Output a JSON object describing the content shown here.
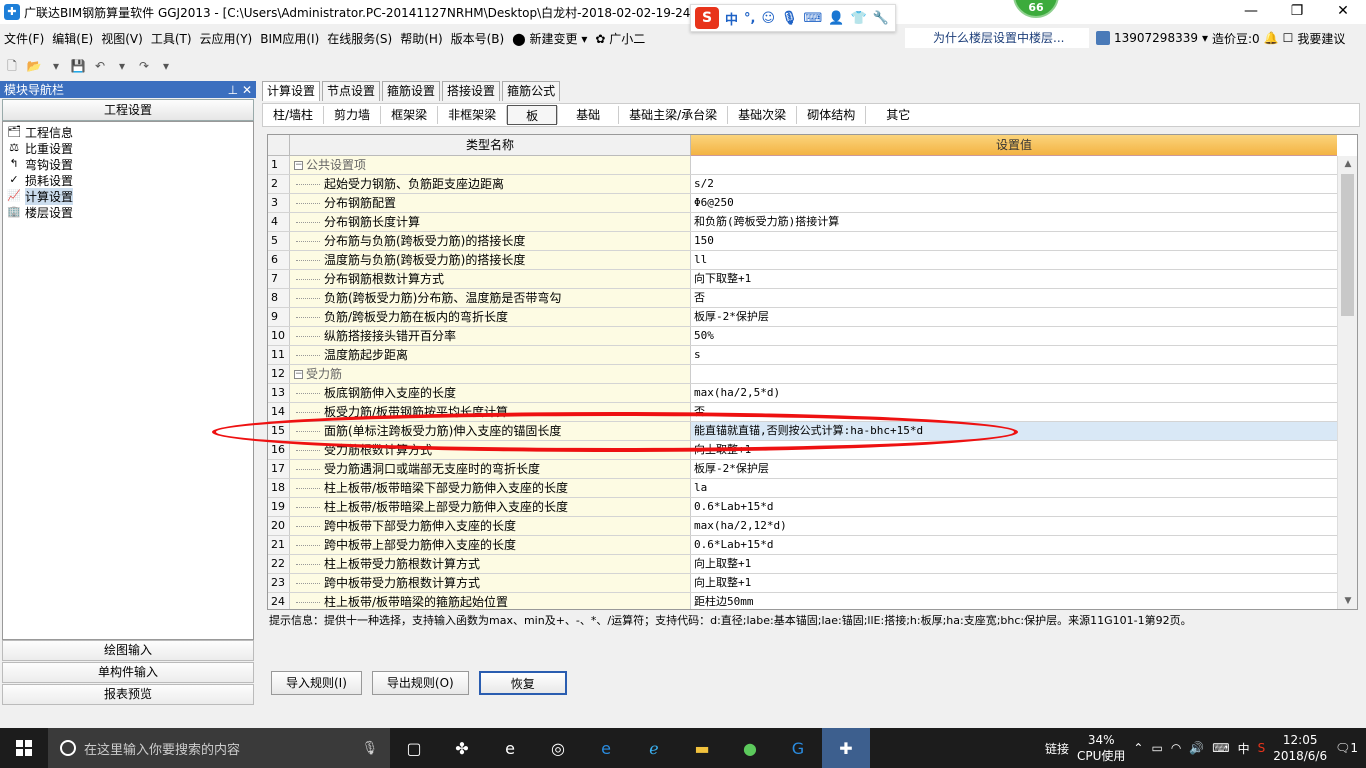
{
  "window": {
    "title": "广联达BIM钢筋算量软件 GGJ2013 - [C:\\Users\\Administrator.PC-20141127NRHM\\Desktop\\白龙村-2018-02-02-19-24-35(2666版).GGJ12]",
    "badge": "66",
    "ime": {
      "logo": "S",
      "items": [
        "中",
        "°,",
        "☺",
        "🎙",
        "⌨",
        "👤",
        "👕",
        "🔧"
      ]
    }
  },
  "menu": {
    "items": [
      "文件(F)",
      "编辑(E)",
      "视图(V)",
      "工具(T)",
      "云应用(Y)",
      "BIM应用(I)",
      "在线服务(S)",
      "帮助(H)",
      "版本号(B)",
      "新建变更",
      "广小二"
    ],
    "ad": "为什么楼层设置中楼层...",
    "phone": "13907298339",
    "cost_label": "造价豆:0",
    "suggest": "我要建议"
  },
  "left_panel": {
    "title": "模块导航栏",
    "section_button": "工程设置",
    "tree": [
      {
        "label": "工程信息",
        "icon": "info-icon"
      },
      {
        "label": "比重设置",
        "icon": "ratio-icon"
      },
      {
        "label": "弯钩设置",
        "icon": "hook-icon"
      },
      {
        "label": "损耗设置",
        "icon": "loss-icon"
      },
      {
        "label": "计算设置",
        "icon": "calc-icon"
      },
      {
        "label": "楼层设置",
        "icon": "floor-icon"
      }
    ],
    "bottom_buttons": [
      "绘图输入",
      "单构件输入",
      "报表预览"
    ]
  },
  "tabs_main": [
    "计算设置",
    "节点设置",
    "箍筋设置",
    "搭接设置",
    "箍筋公式"
  ],
  "tabs_sub": [
    "柱/墙柱",
    "剪力墙",
    "框架梁",
    "非框架梁",
    "板",
    "基础",
    "基础主梁/承台梁",
    "基础次梁",
    "砌体结构",
    "其它"
  ],
  "grid": {
    "col_name": "类型名称",
    "col_value": "设置值",
    "rows": [
      {
        "n": "1",
        "name": "公共设置项",
        "value": "",
        "group": true
      },
      {
        "n": "2",
        "name": "起始受力钢筋、负筋距支座边距离",
        "value": "s/2"
      },
      {
        "n": "3",
        "name": "分布钢筋配置",
        "value": "Φ6@250"
      },
      {
        "n": "4",
        "name": "分布钢筋长度计算",
        "value": "和负筋(跨板受力筋)搭接计算"
      },
      {
        "n": "5",
        "name": "分布筋与负筋(跨板受力筋)的搭接长度",
        "value": "150"
      },
      {
        "n": "6",
        "name": "温度筋与负筋(跨板受力筋)的搭接长度",
        "value": "ll"
      },
      {
        "n": "7",
        "name": "分布钢筋根数计算方式",
        "value": "向下取整+1"
      },
      {
        "n": "8",
        "name": "负筋(跨板受力筋)分布筋、温度筋是否带弯勾",
        "value": "否"
      },
      {
        "n": "9",
        "name": "负筋/跨板受力筋在板内的弯折长度",
        "value": "板厚-2*保护层"
      },
      {
        "n": "10",
        "name": "纵筋搭接接头错开百分率",
        "value": "50%"
      },
      {
        "n": "11",
        "name": "温度筋起步距离",
        "value": "s"
      },
      {
        "n": "12",
        "name": "受力筋",
        "value": "",
        "group": true
      },
      {
        "n": "13",
        "name": "板底钢筋伸入支座的长度",
        "value": "max(ha/2,5*d)"
      },
      {
        "n": "14",
        "name": "板受力筋/板带钢筋按平均长度计算",
        "value": "否"
      },
      {
        "n": "15",
        "name": "面筋(单标注跨板受力筋)伸入支座的锚固长度",
        "value": "能直锚就直锚,否则按公式计算:ha-bhc+15*d",
        "selected": true
      },
      {
        "n": "16",
        "name": "受力筋根数计算方式",
        "value": "向上取整+1"
      },
      {
        "n": "17",
        "name": "受力筋遇洞口或端部无支座时的弯折长度",
        "value": "板厚-2*保护层"
      },
      {
        "n": "18",
        "name": "柱上板带/板带暗梁下部受力筋伸入支座的长度",
        "value": "la"
      },
      {
        "n": "19",
        "name": "柱上板带/板带暗梁上部受力筋伸入支座的长度",
        "value": "0.6*Lab+15*d"
      },
      {
        "n": "20",
        "name": "跨中板带下部受力筋伸入支座的长度",
        "value": "max(ha/2,12*d)"
      },
      {
        "n": "21",
        "name": "跨中板带上部受力筋伸入支座的长度",
        "value": "0.6*Lab+15*d"
      },
      {
        "n": "22",
        "name": "柱上板带受力筋根数计算方式",
        "value": "向上取整+1"
      },
      {
        "n": "23",
        "name": "跨中板带受力筋根数计算方式",
        "value": "向上取整+1"
      },
      {
        "n": "24",
        "name": "柱上板带/板带暗梁的箍筋起始位置",
        "value": "距柱边50mm"
      }
    ]
  },
  "hint": "提示信息：提供十一种选择，支持输入函数为max、min及+、-、*、/运算符；支持代码：d:直径;labe:基本锚固;lae:锚固;llE:搭接;h:板厚;ha:支座宽;bhc:保护层。来源11G101-1第92页。",
  "buttons": {
    "import": "导入规则(I)",
    "export": "导出规则(O)",
    "restore": "恢复"
  },
  "taskbar": {
    "search_placeholder": "在这里输入你要搜索的内容",
    "link_label": "链接",
    "cpu_percent": "34%",
    "cpu_label": "CPU使用",
    "ime": "中",
    "time": "12:05",
    "date": "2018/6/6",
    "notif": "1"
  }
}
